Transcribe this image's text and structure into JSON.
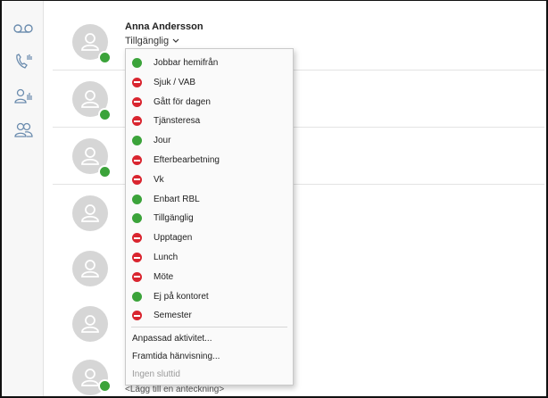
{
  "rail": {
    "icons": [
      "voicemail-icon",
      "call-history-icon",
      "contacts-presence-icon",
      "groups-icon"
    ]
  },
  "contact": {
    "name": "Anna Andersson",
    "status": "Tillgänglig",
    "note": "<Lägg till en anteckning>"
  },
  "colors": {
    "available": "#3ba33a",
    "busy": "#d9252f"
  },
  "menu": {
    "statuses": [
      {
        "label": "Jobbar hemifrån",
        "kind": "available"
      },
      {
        "label": "Sjuk / VAB",
        "kind": "busy"
      },
      {
        "label": "Gått för dagen",
        "kind": "busy"
      },
      {
        "label": "Tjänsteresa",
        "kind": "busy"
      },
      {
        "label": "Jour",
        "kind": "available"
      },
      {
        "label": "Efterbearbetning",
        "kind": "busy"
      },
      {
        "label": "Vk",
        "kind": "busy"
      },
      {
        "label": "Enbart RBL",
        "kind": "available"
      },
      {
        "label": "Tillgänglig",
        "kind": "available"
      },
      {
        "label": "Upptagen",
        "kind": "busy"
      },
      {
        "label": "Lunch",
        "kind": "busy"
      },
      {
        "label": "Möte",
        "kind": "busy"
      },
      {
        "label": "Ej på kontoret",
        "kind": "available"
      },
      {
        "label": "Semester",
        "kind": "busy"
      }
    ],
    "actions": {
      "custom_activity": "Anpassad aktivitet...",
      "future_redirect": "Framtida hänvisning...",
      "no_end_time": "Ingen sluttid"
    }
  }
}
